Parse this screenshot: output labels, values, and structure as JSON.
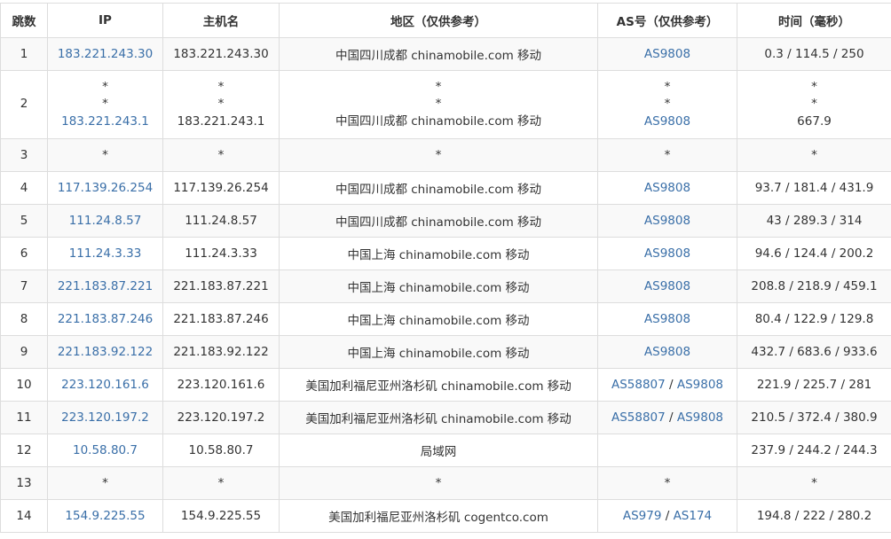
{
  "headers": [
    "跳数",
    "IP",
    "主机名",
    "地区（仅供参考）",
    "AS号（仅供参考）",
    "时间（毫秒）"
  ],
  "rows": [
    {
      "hop": "1",
      "ip": [
        "183.221.243.30"
      ],
      "host": [
        "183.221.243.30"
      ],
      "region": [
        "中国四川成都 chinamobile.com 移动"
      ],
      "as": [
        [
          "AS9808"
        ]
      ],
      "time": [
        "0.3 / 114.5 / 250"
      ]
    },
    {
      "hop": "2",
      "ip": [
        "*",
        "*",
        "183.221.243.1"
      ],
      "host": [
        "*",
        "*",
        "183.221.243.1"
      ],
      "region": [
        "*",
        "*",
        "中国四川成都 chinamobile.com 移动"
      ],
      "as": [
        [
          "*"
        ],
        [
          "*"
        ],
        [
          "AS9808"
        ]
      ],
      "time": [
        "*",
        "*",
        "667.9"
      ]
    },
    {
      "hop": "3",
      "ip": [
        "*"
      ],
      "host": [
        "*"
      ],
      "region": [
        "*"
      ],
      "as": [
        [
          "*"
        ]
      ],
      "time": [
        "*"
      ]
    },
    {
      "hop": "4",
      "ip": [
        "117.139.26.254"
      ],
      "host": [
        "117.139.26.254"
      ],
      "region": [
        "中国四川成都 chinamobile.com 移动"
      ],
      "as": [
        [
          "AS9808"
        ]
      ],
      "time": [
        "93.7 / 181.4 / 431.9"
      ]
    },
    {
      "hop": "5",
      "ip": [
        "111.24.8.57"
      ],
      "host": [
        "111.24.8.57"
      ],
      "region": [
        "中国四川成都 chinamobile.com 移动"
      ],
      "as": [
        [
          "AS9808"
        ]
      ],
      "time": [
        "43 / 289.3 / 314"
      ]
    },
    {
      "hop": "6",
      "ip": [
        "111.24.3.33"
      ],
      "host": [
        "111.24.3.33"
      ],
      "region": [
        "中国上海 chinamobile.com 移动"
      ],
      "as": [
        [
          "AS9808"
        ]
      ],
      "time": [
        "94.6 / 124.4 / 200.2"
      ]
    },
    {
      "hop": "7",
      "ip": [
        "221.183.87.221"
      ],
      "host": [
        "221.183.87.221"
      ],
      "region": [
        "中国上海 chinamobile.com 移动"
      ],
      "as": [
        [
          "AS9808"
        ]
      ],
      "time": [
        "208.8 / 218.9 / 459.1"
      ]
    },
    {
      "hop": "8",
      "ip": [
        "221.183.87.246"
      ],
      "host": [
        "221.183.87.246"
      ],
      "region": [
        "中国上海 chinamobile.com 移动"
      ],
      "as": [
        [
          "AS9808"
        ]
      ],
      "time": [
        "80.4 / 122.9 / 129.8"
      ]
    },
    {
      "hop": "9",
      "ip": [
        "221.183.92.122"
      ],
      "host": [
        "221.183.92.122"
      ],
      "region": [
        "中国上海 chinamobile.com 移动"
      ],
      "as": [
        [
          "AS9808"
        ]
      ],
      "time": [
        "432.7 / 683.6 / 933.6"
      ]
    },
    {
      "hop": "10",
      "ip": [
        "223.120.161.6"
      ],
      "host": [
        "223.120.161.6"
      ],
      "region": [
        "美国加利福尼亚州洛杉矶 chinamobile.com 移动"
      ],
      "as": [
        [
          "AS58807",
          "AS9808"
        ]
      ],
      "time": [
        "221.9 / 225.7 / 281"
      ]
    },
    {
      "hop": "11",
      "ip": [
        "223.120.197.2"
      ],
      "host": [
        "223.120.197.2"
      ],
      "region": [
        "美国加利福尼亚州洛杉矶 chinamobile.com 移动"
      ],
      "as": [
        [
          "AS58807",
          "AS9808"
        ]
      ],
      "time": [
        "210.5 / 372.4 / 380.9"
      ]
    },
    {
      "hop": "12",
      "ip": [
        "10.58.80.7"
      ],
      "host": [
        "10.58.80.7"
      ],
      "region": [
        "局域网"
      ],
      "as": [
        []
      ],
      "time": [
        "237.9 / 244.2 / 244.3"
      ]
    },
    {
      "hop": "13",
      "ip": [
        "*"
      ],
      "host": [
        "*"
      ],
      "region": [
        "*"
      ],
      "as": [
        [
          "*"
        ]
      ],
      "time": [
        "*"
      ]
    },
    {
      "hop": "14",
      "ip": [
        "154.9.225.55"
      ],
      "host": [
        "154.9.225.55"
      ],
      "region": [
        "美国加利福尼亚州洛杉矶 cogentco.com"
      ],
      "as": [
        [
          "AS979",
          "AS174"
        ]
      ],
      "time": [
        "194.8 / 222 / 280.2"
      ]
    }
  ],
  "colors": {
    "link": "#3a6fa8",
    "border": "#dddddd",
    "stripe": "#f9f9f9",
    "text": "#333333"
  }
}
